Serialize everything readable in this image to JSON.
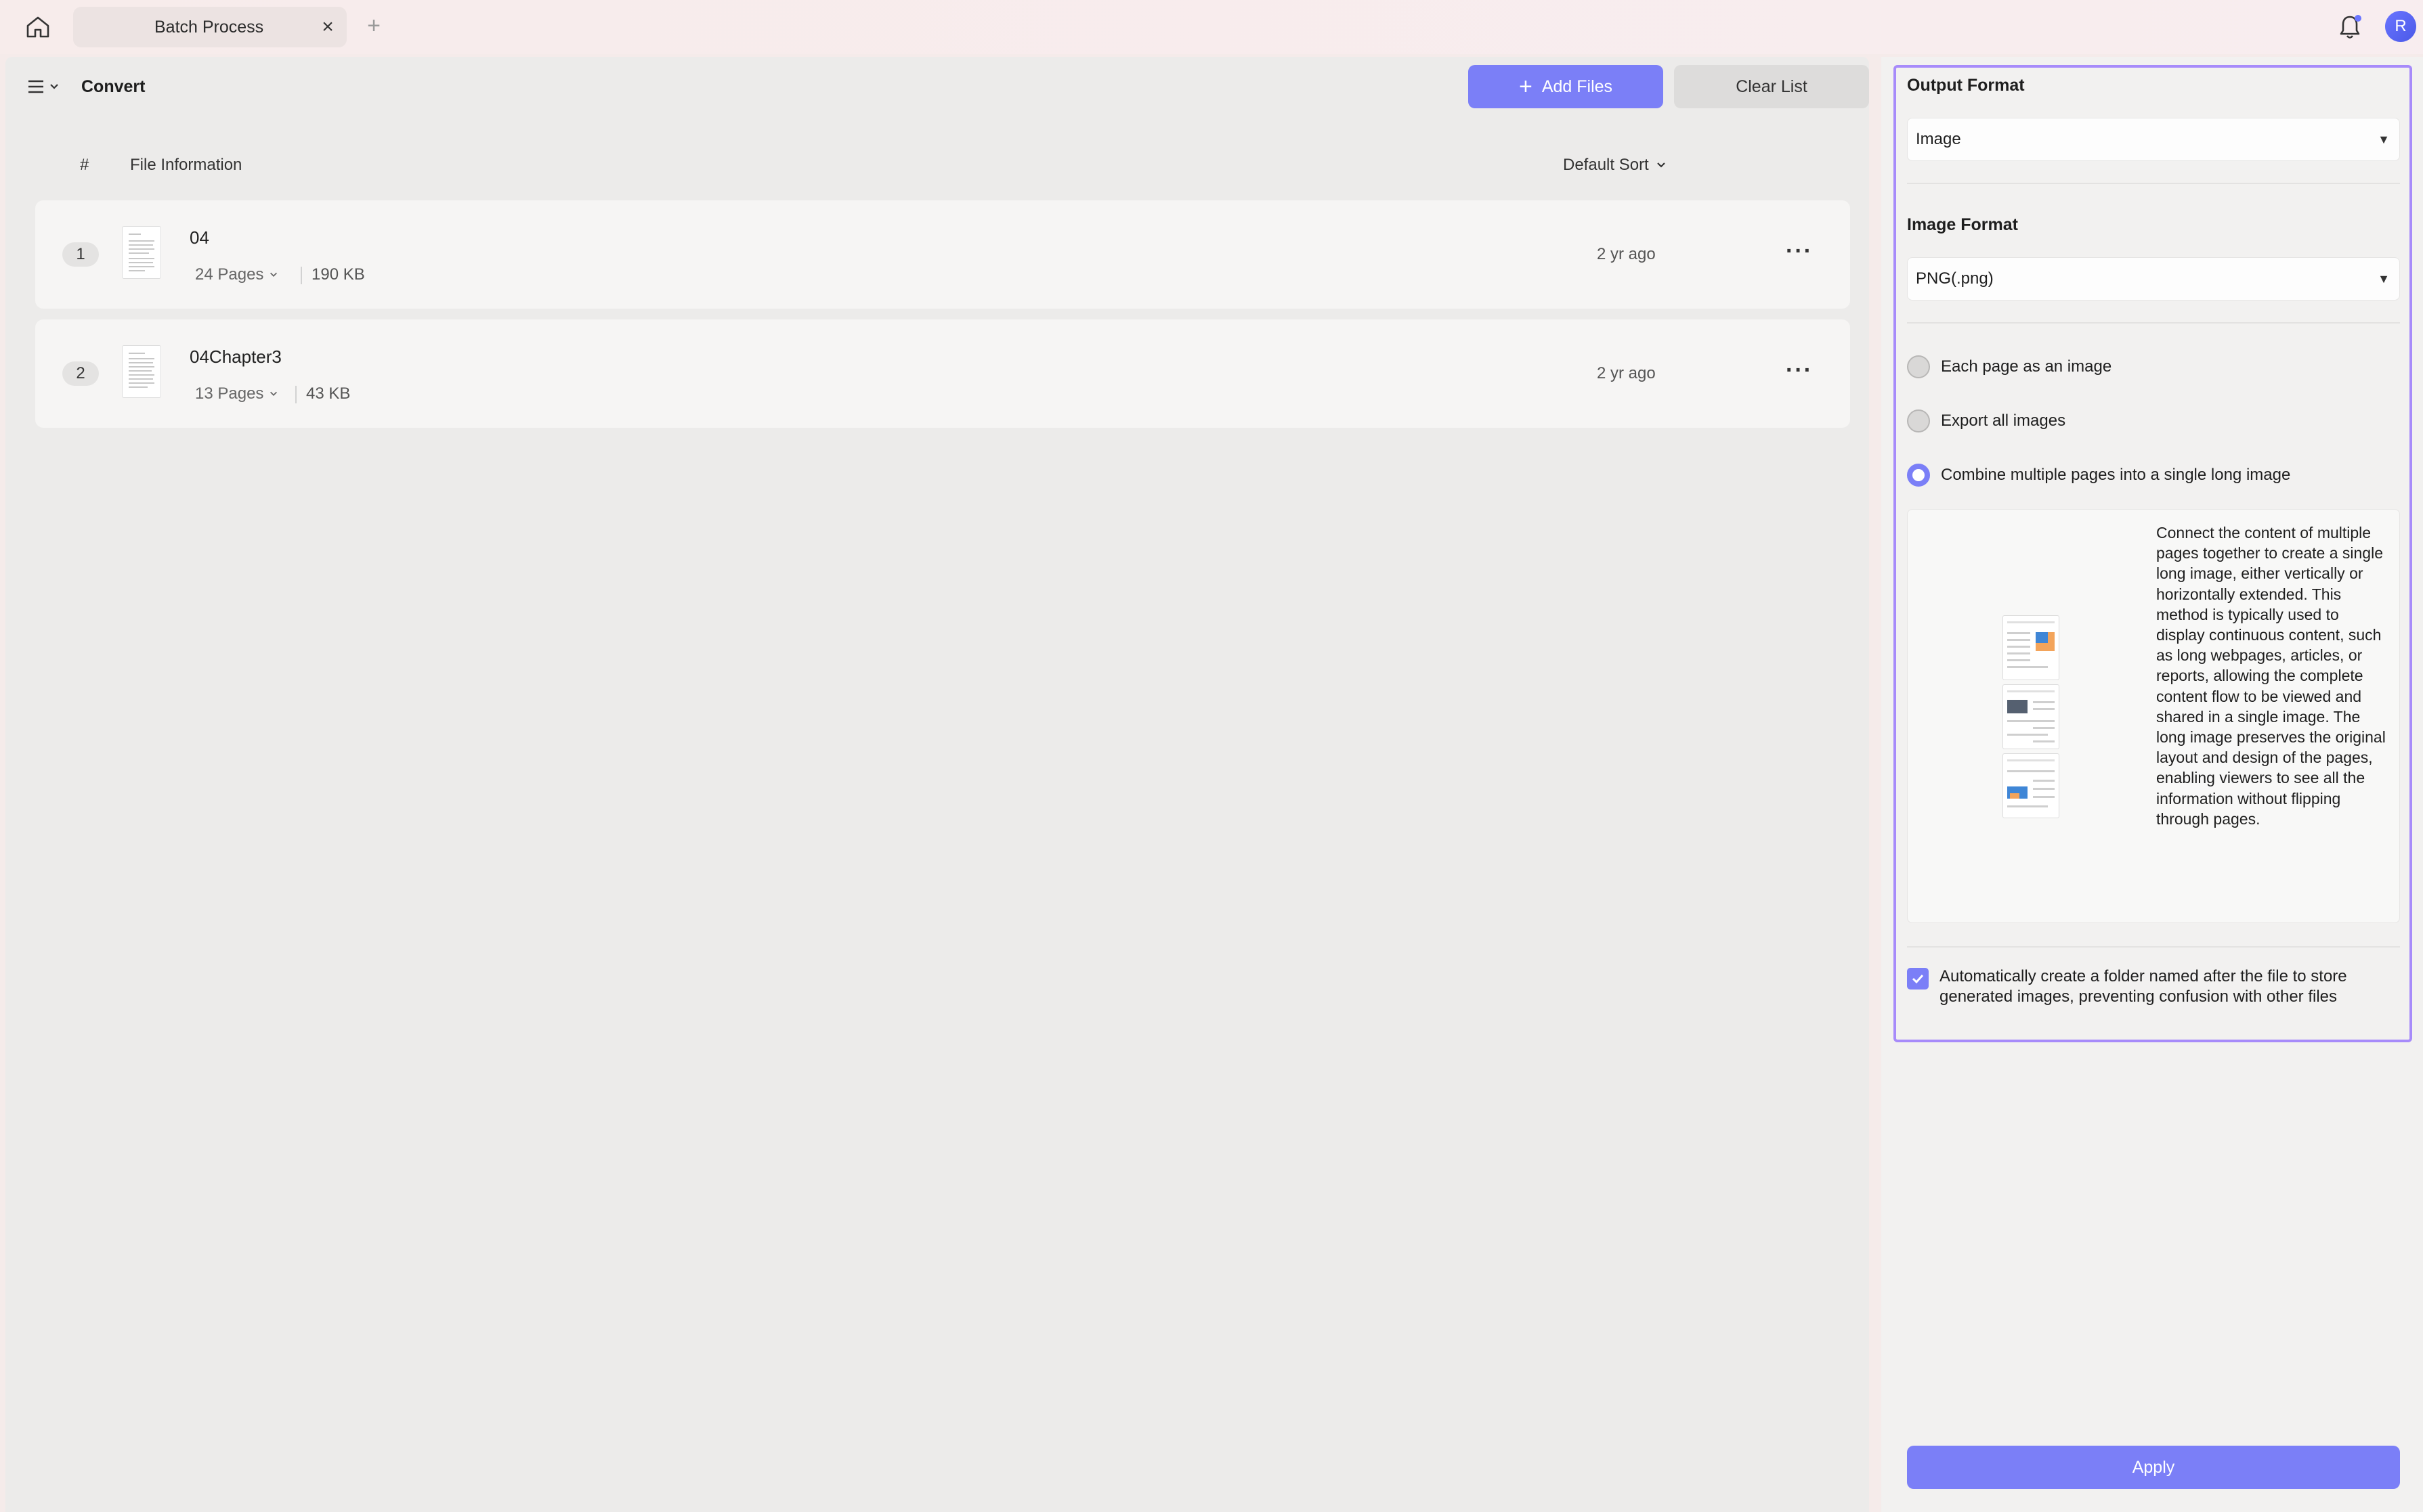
{
  "tab": {
    "title": "Batch Process",
    "close": "×",
    "add": "+"
  },
  "user": {
    "avatar_letter": "R"
  },
  "toolbar": {
    "title": "Convert",
    "add_files": "Add Files",
    "add_icon": "+",
    "clear_list": "Clear List"
  },
  "table": {
    "col_hash": "#",
    "col_info": "File Information",
    "sort_label": "Default Sort",
    "rows": [
      {
        "num": "1",
        "name": "04",
        "pages": "24 Pages",
        "size": "190 KB",
        "time": "2 yr ago",
        "more": "···"
      },
      {
        "num": "2",
        "name": "04Chapter3",
        "pages": "13 Pages",
        "size": "43 KB",
        "time": "2 yr ago",
        "more": "···"
      }
    ]
  },
  "settings": {
    "output_format_label": "Output Format",
    "output_format_value": "Image",
    "image_format_label": "Image Format",
    "image_format_value": "PNG(.png)",
    "caret": "▼",
    "options": [
      {
        "label": "Each page as an image",
        "selected": false
      },
      {
        "label": "Export all images",
        "selected": false
      },
      {
        "label": "Combine multiple pages into a single long image",
        "selected": true
      }
    ],
    "description": "Connect the content of multiple pages together to create a single long image, either vertically or horizontally extended. This method is typically used to display continuous content, such as long webpages, articles, or reports, allowing the complete content flow to be viewed and shared in a single image. The long image preserves the original layout and design of the pages, enabling viewers to see all the information without flipping through pages.",
    "auto_folder_text": "Automatically create a folder named after the file to store generated images, preventing confusion with other files",
    "auto_folder_checked": true,
    "apply": "Apply"
  },
  "colors": {
    "accent": "#7b7ff7",
    "highlight_border": "#a78bfa"
  },
  "icons": [
    "home-icon",
    "close-icon",
    "plus-icon",
    "bell-icon",
    "menu-icon",
    "chevron-down-icon",
    "more-icon",
    "check-icon"
  ]
}
